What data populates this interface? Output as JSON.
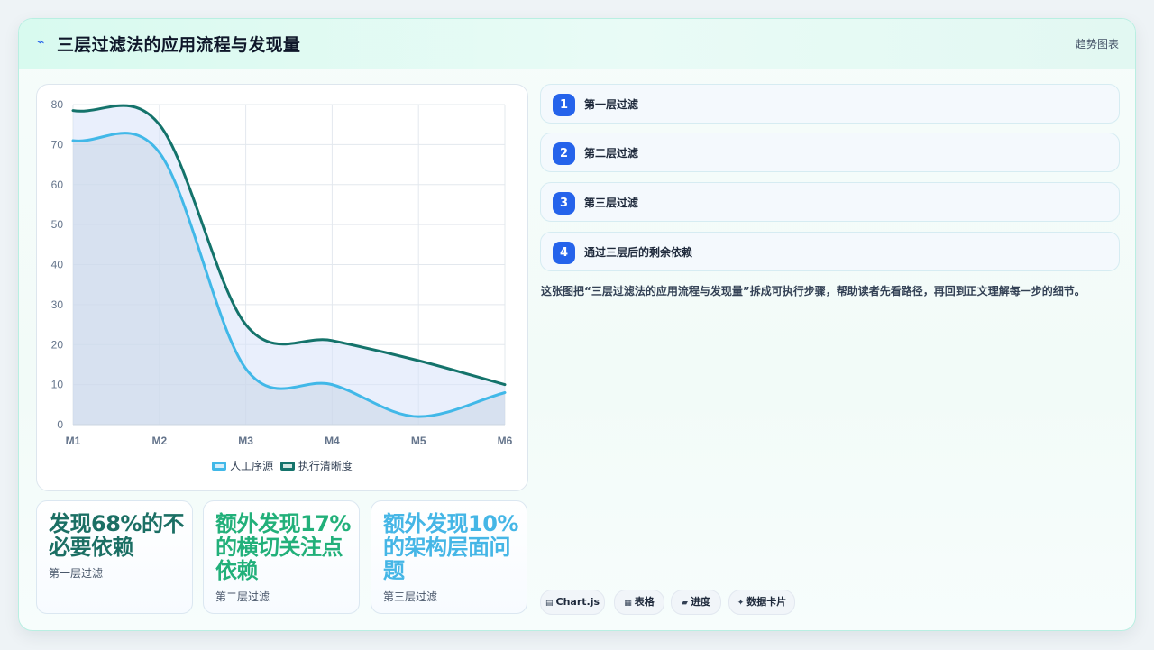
{
  "header": {
    "icon": "lightning-icon",
    "title": "三层过滤法的应用流程与发现量",
    "tag": "趋势图表"
  },
  "chart_data": {
    "type": "area",
    "categories": [
      "M1",
      "M2",
      "M3",
      "M4",
      "M5",
      "M6"
    ],
    "series": [
      {
        "name": "人工序源",
        "values": [
          71,
          68,
          14,
          10,
          2,
          8
        ],
        "color": "#41b8e8"
      },
      {
        "name": "执行清晰度",
        "values": [
          78.5,
          75,
          25,
          21,
          16,
          10
        ],
        "color": "#14736b"
      }
    ],
    "ylim": [
      0,
      80
    ],
    "yticks": [
      0,
      10,
      20,
      30,
      40,
      50,
      60,
      70,
      80
    ],
    "grid": true,
    "legend_position": "bottom"
  },
  "stats": [
    {
      "value": "发现68%的不必要依赖",
      "label": "第一层过滤",
      "color": "#1b6f64"
    },
    {
      "value": "额外发现17%的横切关注点依赖",
      "label": "第二层过滤",
      "color": "#22b07a"
    },
    {
      "value": "额外发现10%的架构层面问题",
      "label": "第三层过滤",
      "color": "#45b6e6"
    }
  ],
  "steps": [
    {
      "num": "1",
      "label": "第一层过滤"
    },
    {
      "num": "2",
      "label": "第二层过滤"
    },
    {
      "num": "3",
      "label": "第三层过滤"
    },
    {
      "num": "4",
      "label": "通过三层后的剩余依赖"
    }
  ],
  "description": "这张图把“三层过滤法的应用流程与发现量”拆成可执行步骤，帮助读者先看路径，再回到正文理解每一步的细节。",
  "chips": [
    {
      "icon": "▤",
      "label": "Chart.js"
    },
    {
      "icon": "▦",
      "label": "表格"
    },
    {
      "icon": "▰",
      "label": "进度"
    },
    {
      "icon": "✦",
      "label": "数据卡片"
    }
  ]
}
